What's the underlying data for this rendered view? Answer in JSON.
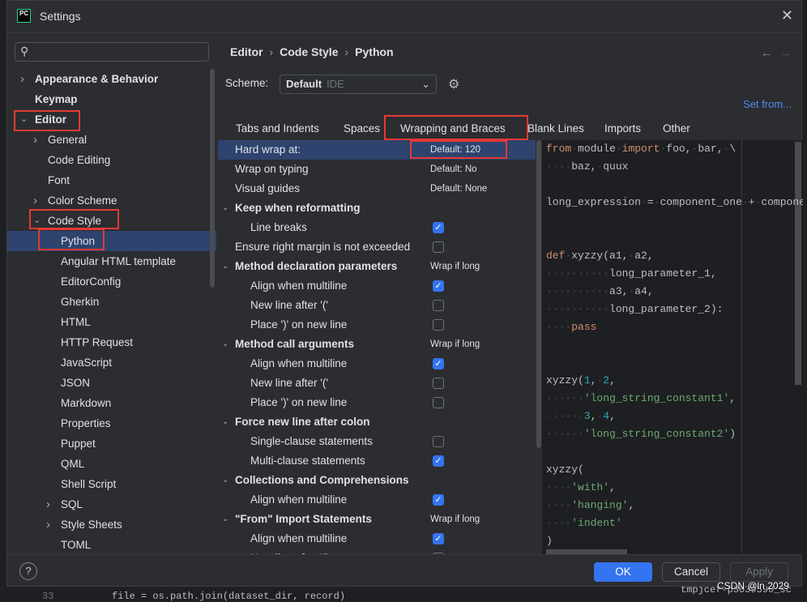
{
  "window": {
    "title": "Settings",
    "logo": "PC",
    "close_icon": "close-icon"
  },
  "search": {
    "placeholder": "",
    "icon": "search-icon"
  },
  "tree": [
    {
      "label": "Appearance & Behavior",
      "level": 0,
      "chevron": ">",
      "bold": true
    },
    {
      "label": "Keymap",
      "level": 0,
      "chevron": "",
      "bold": true
    },
    {
      "label": "Editor",
      "level": 0,
      "chevron": "v",
      "bold": true
    },
    {
      "label": "General",
      "level": 1,
      "chevron": ">"
    },
    {
      "label": "Code Editing",
      "level": 1,
      "chevron": ""
    },
    {
      "label": "Font",
      "level": 1,
      "chevron": ""
    },
    {
      "label": "Color Scheme",
      "level": 1,
      "chevron": ">"
    },
    {
      "label": "Code Style",
      "level": 1,
      "chevron": "v"
    },
    {
      "label": "Python",
      "level": 2,
      "chevron": "",
      "selected": true
    },
    {
      "label": "Angular HTML template",
      "level": 2,
      "chevron": ""
    },
    {
      "label": "EditorConfig",
      "level": 2,
      "chevron": ""
    },
    {
      "label": "Gherkin",
      "level": 2,
      "chevron": ""
    },
    {
      "label": "HTML",
      "level": 2,
      "chevron": ""
    },
    {
      "label": "HTTP Request",
      "level": 2,
      "chevron": ""
    },
    {
      "label": "JavaScript",
      "level": 2,
      "chevron": ""
    },
    {
      "label": "JSON",
      "level": 2,
      "chevron": ""
    },
    {
      "label": "Markdown",
      "level": 2,
      "chevron": ""
    },
    {
      "label": "Properties",
      "level": 2,
      "chevron": ""
    },
    {
      "label": "Puppet",
      "level": 2,
      "chevron": ""
    },
    {
      "label": "QML",
      "level": 2,
      "chevron": ""
    },
    {
      "label": "Shell Script",
      "level": 2,
      "chevron": ""
    },
    {
      "label": "SQL",
      "level": 2,
      "chevron": ">"
    },
    {
      "label": "Style Sheets",
      "level": 2,
      "chevron": ">"
    },
    {
      "label": "TOML",
      "level": 2,
      "chevron": ""
    }
  ],
  "breadcrumb": [
    "Editor",
    "Code Style",
    "Python"
  ],
  "scheme": {
    "label": "Scheme:",
    "value": "Default",
    "tag": "IDE"
  },
  "set_from": "Set from...",
  "tabs": [
    "Tabs and Indents",
    "Spaces",
    "Wrapping and Braces",
    "Blank Lines",
    "Imports",
    "Other"
  ],
  "active_tab": "Wrapping and Braces",
  "options": [
    {
      "label": "Hard wrap at:",
      "value": "Default: 120",
      "indent": 0,
      "selected": true
    },
    {
      "label": "Wrap on typing",
      "value": "Default: No",
      "indent": 0
    },
    {
      "label": "Visual guides",
      "value": "Default: None",
      "indent": 0
    },
    {
      "label": "Keep when reformatting",
      "group": true
    },
    {
      "label": "Line breaks",
      "indent": 1,
      "checked": true
    },
    {
      "label": "Ensure right margin is not exceeded",
      "indent": 0,
      "checked": false
    },
    {
      "label": "Method declaration parameters",
      "group": true,
      "value": "Wrap if long"
    },
    {
      "label": "Align when multiline",
      "indent": 1,
      "checked": true
    },
    {
      "label": "New line after '('",
      "indent": 1,
      "checked": false
    },
    {
      "label": "Place ')' on new line",
      "indent": 1,
      "checked": false
    },
    {
      "label": "Method call arguments",
      "group": true,
      "value": "Wrap if long"
    },
    {
      "label": "Align when multiline",
      "indent": 1,
      "checked": true
    },
    {
      "label": "New line after '('",
      "indent": 1,
      "checked": false
    },
    {
      "label": "Place ')' on new line",
      "indent": 1,
      "checked": false
    },
    {
      "label": "Force new line after colon",
      "group": true
    },
    {
      "label": "Single-clause statements",
      "indent": 1,
      "checked": false
    },
    {
      "label": "Multi-clause statements",
      "indent": 1,
      "checked": true
    },
    {
      "label": "Collections and Comprehensions",
      "group": true
    },
    {
      "label": "Align when multiline",
      "indent": 1,
      "checked": true
    },
    {
      "label": "\"From\" Import Statements",
      "group": true,
      "value": "Wrap if long"
    },
    {
      "label": "Align when multiline",
      "indent": 1,
      "checked": true
    },
    {
      "label": "New line after '('",
      "indent": 1,
      "checked": false
    }
  ],
  "code": [
    [
      [
        "from",
        "kw"
      ],
      [
        "·",
        "ws"
      ],
      [
        "module",
        ""
      ],
      [
        "·",
        "ws"
      ],
      [
        "import",
        "kw"
      ],
      [
        "·",
        "ws"
      ],
      [
        "foo,",
        ""
      ],
      [
        "·",
        "ws"
      ],
      [
        "bar,",
        ""
      ],
      [
        "·",
        "ws"
      ],
      [
        "\\",
        ""
      ]
    ],
    [
      [
        "····",
        "ws"
      ],
      [
        "baz,",
        ""
      ],
      [
        "·",
        "ws"
      ],
      [
        "quux",
        ""
      ]
    ],
    [],
    [
      [
        "long_expression",
        ""
      ],
      [
        "·",
        "ws"
      ],
      [
        "=",
        ""
      ],
      [
        "·",
        "ws"
      ],
      [
        "component_one",
        ""
      ],
      [
        "·",
        "ws"
      ],
      [
        "+",
        ""
      ],
      [
        "·",
        "ws"
      ],
      [
        "component_two",
        ""
      ]
    ],
    [],
    [],
    [
      [
        "def",
        "kw"
      ],
      [
        "·",
        "ws"
      ],
      [
        "xyzzy(a1,",
        ""
      ],
      [
        "·",
        "ws"
      ],
      [
        "a2,",
        ""
      ]
    ],
    [
      [
        "··········",
        "ws"
      ],
      [
        "long_parameter_1,",
        ""
      ]
    ],
    [
      [
        "··········",
        "ws"
      ],
      [
        "a3,",
        ""
      ],
      [
        "·",
        "ws"
      ],
      [
        "a4,",
        ""
      ]
    ],
    [
      [
        "··········",
        "ws"
      ],
      [
        "long_parameter_2):",
        ""
      ]
    ],
    [
      [
        "····",
        "ws"
      ],
      [
        "pass",
        "kw"
      ]
    ],
    [],
    [],
    [
      [
        "xyzzy(",
        ""
      ],
      [
        "1",
        "num"
      ],
      [
        ",",
        ""
      ],
      [
        "·",
        "ws"
      ],
      [
        "2",
        "num"
      ],
      [
        ",",
        ""
      ]
    ],
    [
      [
        "······",
        "ws"
      ],
      [
        "'long_string_constant1'",
        "str"
      ],
      [
        ",",
        ""
      ]
    ],
    [
      [
        "······",
        "ws"
      ],
      [
        "3",
        "num"
      ],
      [
        ",",
        ""
      ],
      [
        "·",
        "ws"
      ],
      [
        "4",
        "num"
      ],
      [
        ",",
        ""
      ]
    ],
    [
      [
        "······",
        "ws"
      ],
      [
        "'long_string_constant2'",
        "str"
      ],
      [
        ")",
        ""
      ]
    ],
    [],
    [
      [
        "xyzzy(",
        ""
      ]
    ],
    [
      [
        "····",
        "ws"
      ],
      [
        "'with'",
        "str"
      ],
      [
        ",",
        ""
      ]
    ],
    [
      [
        "····",
        "ws"
      ],
      [
        "'hanging'",
        "str"
      ],
      [
        ",",
        ""
      ]
    ],
    [
      [
        "····",
        "ws"
      ],
      [
        "'indent'",
        "str"
      ]
    ],
    [
      [
        ")",
        ""
      ]
    ]
  ],
  "footer": {
    "help": "?",
    "ok": "OK",
    "cancel": "Cancel",
    "apply": "Apply"
  },
  "watermark": "CSDN @ln 2029",
  "background": {
    "line_number": "33",
    "code": "file = os.path.join(dataset_dir, record)",
    "right": "tmpjcef-p3039590_sc"
  },
  "colors": {
    "accent": "#3574f0",
    "selection": "#2e436e",
    "highlight": "#e53935"
  }
}
